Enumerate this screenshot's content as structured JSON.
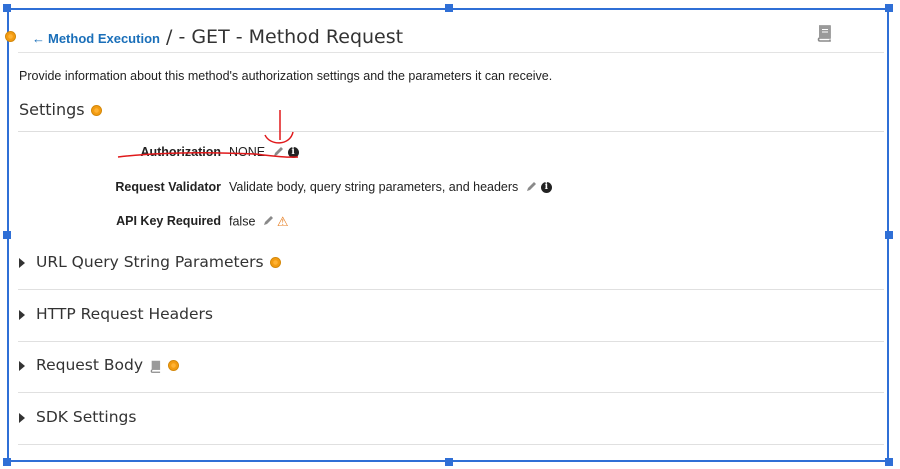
{
  "header": {
    "back_label": "Method Execution",
    "title": "/ - GET - Method Request"
  },
  "description": "Provide information about this method's authorization settings and the parameters it can receive.",
  "settings": {
    "heading": "Settings",
    "rows": [
      {
        "label": "Authorization",
        "value": "NONE"
      },
      {
        "label": "Request Validator",
        "value": "Validate body, query string parameters, and headers"
      },
      {
        "label": "API Key Required",
        "value": "false"
      }
    ]
  },
  "sections": [
    {
      "title": "URL Query String Parameters"
    },
    {
      "title": "HTTP Request Headers"
    },
    {
      "title": "Request Body"
    },
    {
      "title": "SDK Settings"
    }
  ],
  "icons": {
    "back": "arrow-left-icon",
    "docs": "book-icon",
    "edit": "pencil-icon",
    "info": "info-icon",
    "warning": "warning-icon",
    "required": "orange-dot-icon"
  },
  "colors": {
    "link": "#1a6fb9",
    "accent_orange": "#f39c12",
    "selection_frame": "#2f6fd6",
    "annotation_red": "#e0191b"
  }
}
